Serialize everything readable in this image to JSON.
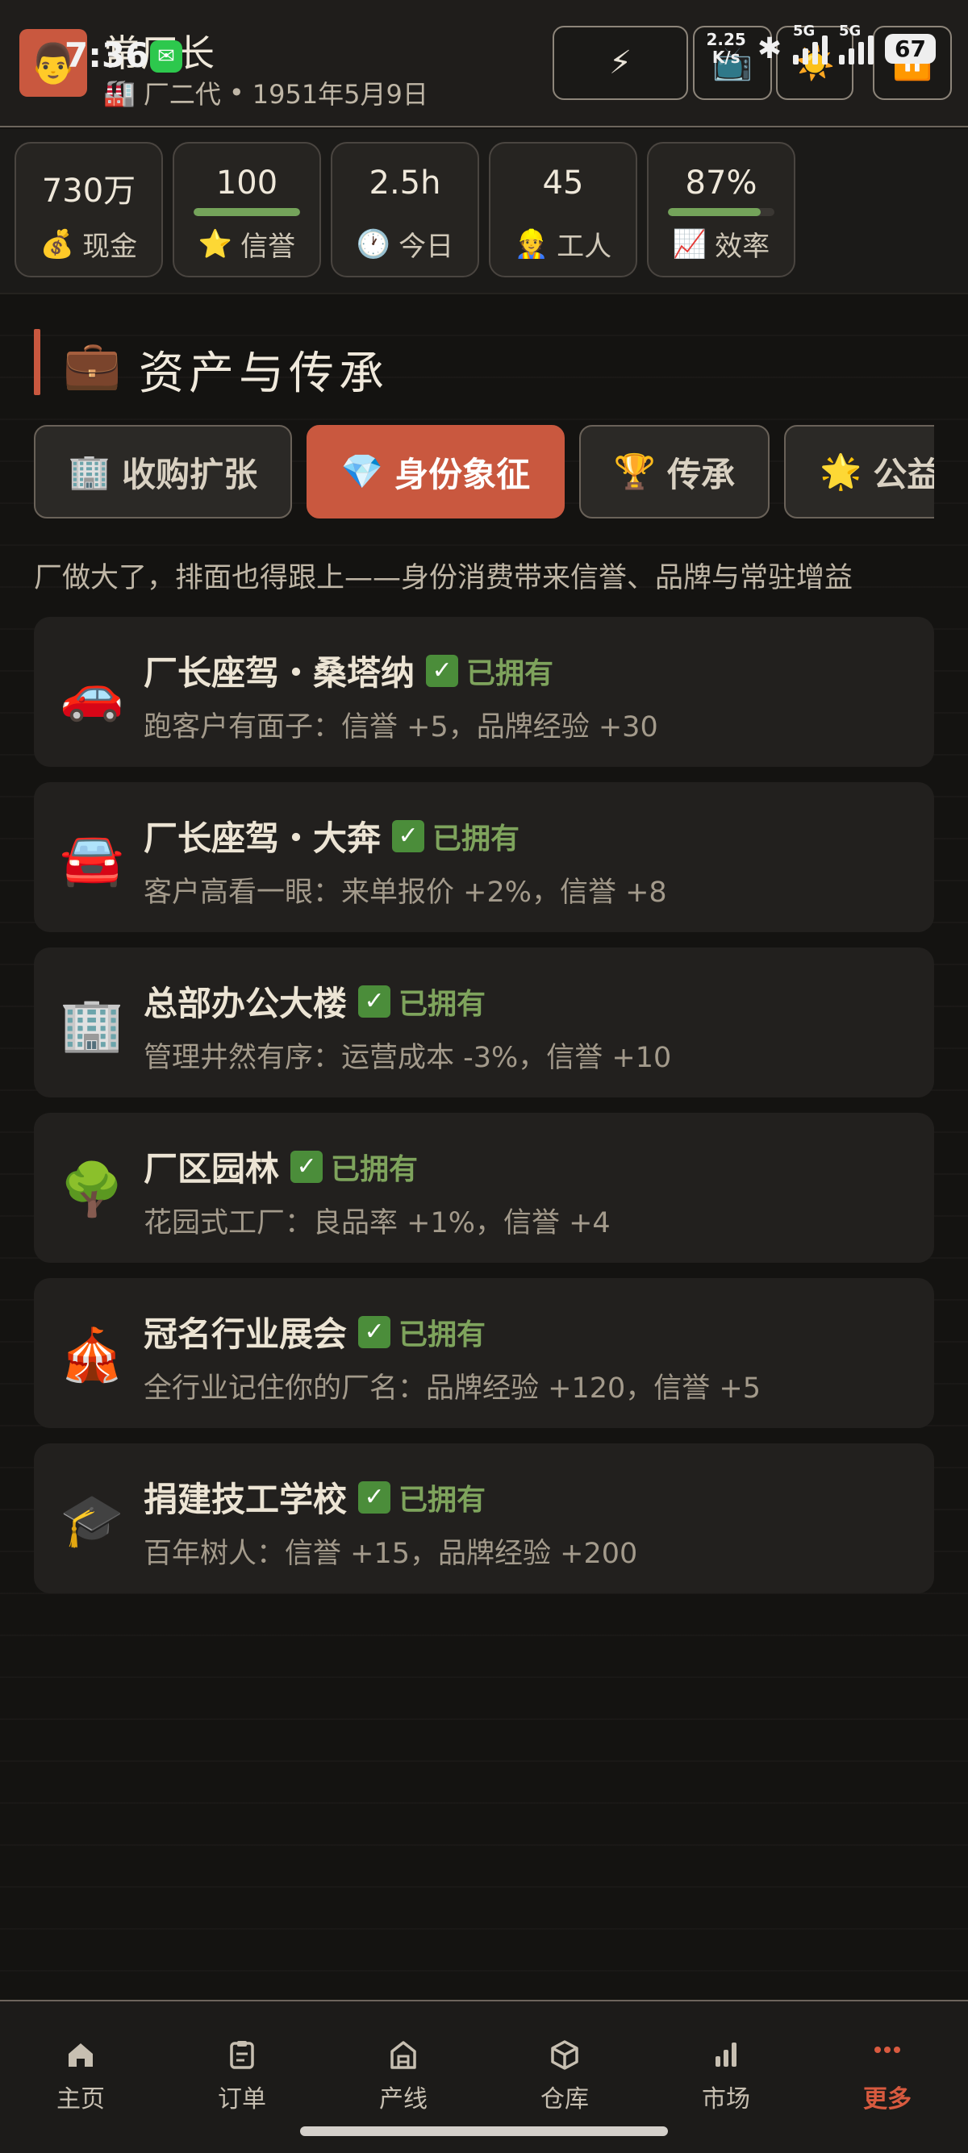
{
  "status_bar": {
    "time": "7:36",
    "net_speed_value": "2.25",
    "net_speed_unit": "K/s",
    "signal1": "5G",
    "signal2": "5G",
    "battery": "67"
  },
  "header": {
    "name": "常厂长",
    "subtitle_role": "厂二代",
    "separator": "•",
    "date": "1951年5月9日"
  },
  "stats": [
    {
      "value": "730万",
      "label": "现金",
      "icon": "💰",
      "bar": null
    },
    {
      "value": "100",
      "label": "信誉",
      "icon": "⭐",
      "bar": 1.0
    },
    {
      "value": "2.5h",
      "label": "今日",
      "icon": "🕐",
      "bar": null
    },
    {
      "value": "45",
      "label": "工人",
      "icon": "👷",
      "bar": null
    },
    {
      "value": "87%",
      "label": "效率",
      "icon": "📈",
      "bar": 0.87
    }
  ],
  "section": {
    "icon": "💼",
    "title": "资产与传承",
    "description": "厂做大了，排面也得跟上——身份消费带来信誉、品牌与常驻增益"
  },
  "tabs": [
    {
      "icon": "🏢",
      "label": "收购扩张",
      "active": false
    },
    {
      "icon": "💎",
      "label": "身份象征",
      "active": true
    },
    {
      "icon": "🏆",
      "label": "传承",
      "active": false
    },
    {
      "icon": "🌟",
      "label": "公益",
      "active": false
    }
  ],
  "items": [
    {
      "icon": "🚗",
      "title": "厂长座驾・桑塔纳",
      "status": "已拥有",
      "effect": "跑客户有面子：信誉 +5，品牌经验 +30"
    },
    {
      "icon": "🚘",
      "title": "厂长座驾・大奔",
      "status": "已拥有",
      "effect": "客户高看一眼：来单报价 +2%，信誉 +8"
    },
    {
      "icon": "🏢",
      "title": "总部办公大楼",
      "status": "已拥有",
      "effect": "管理井然有序：运营成本 -3%，信誉 +10"
    },
    {
      "icon": "🌳",
      "title": "厂区园林",
      "status": "已拥有",
      "effect": "花园式工厂：良品率 +1%，信誉 +4"
    },
    {
      "icon": "🎪",
      "title": "冠名行业展会",
      "status": "已拥有",
      "effect": "全行业记住你的厂名：品牌经验 +120，信誉 +5"
    },
    {
      "icon": "🎓",
      "title": "捐建技工学校",
      "status": "已拥有",
      "effect": "百年树人：信誉 +15，品牌经验 +200"
    }
  ],
  "nav": [
    {
      "icon": "home-icon",
      "label": "主页",
      "active": false
    },
    {
      "icon": "clipboard-icon",
      "label": "订单",
      "active": false
    },
    {
      "icon": "factory-icon",
      "label": "产线",
      "active": false
    },
    {
      "icon": "box-icon",
      "label": "仓库",
      "active": false
    },
    {
      "icon": "bar-chart-icon",
      "label": "市场",
      "active": false
    },
    {
      "icon": "more-dots-icon",
      "label": "更多",
      "active": true
    }
  ],
  "colors": {
    "accent": "#c9583f",
    "success": "#7ea35c",
    "background": "#141311"
  }
}
